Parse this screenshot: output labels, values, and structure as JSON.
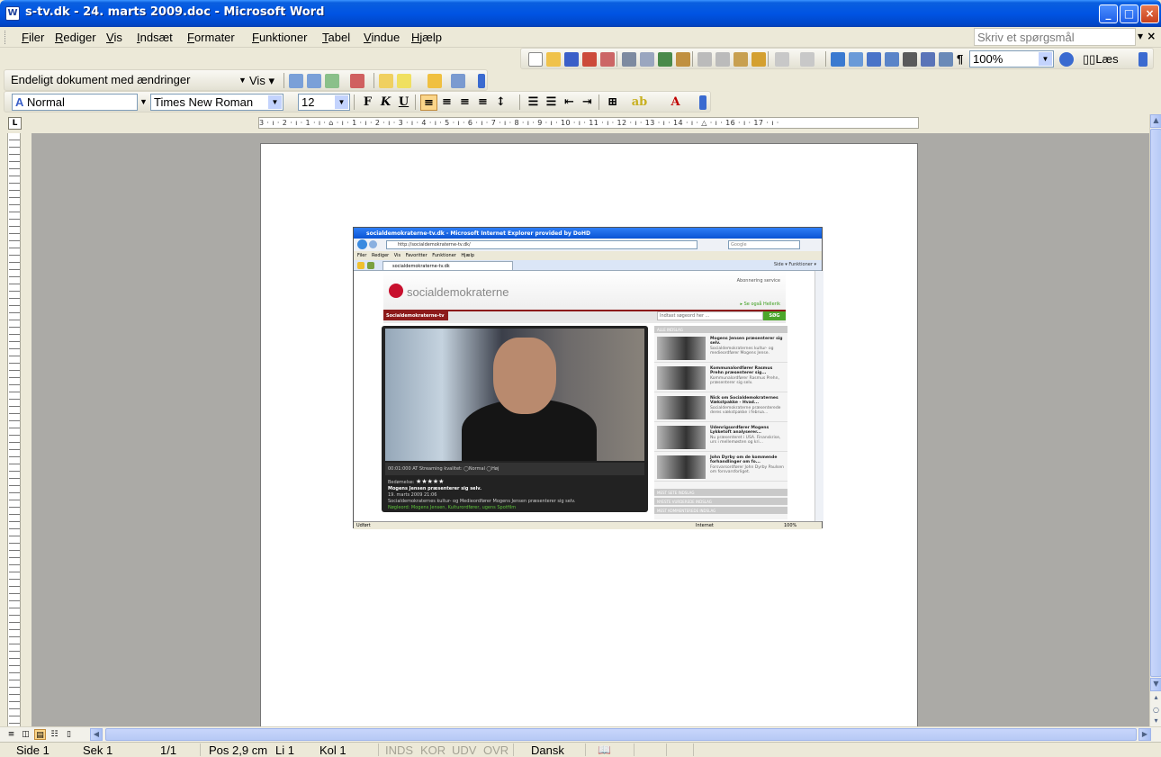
{
  "window": {
    "title": "s-tv.dk - 24. marts 2009.doc - Microsoft Word",
    "minimize": "_",
    "maximize": "□",
    "close": "×"
  },
  "menu": {
    "items": [
      "Filer",
      "Rediger",
      "Vis",
      "Indsæt",
      "Formater",
      "Funktioner",
      "Tabel",
      "Vindue",
      "Hjælp"
    ],
    "ask_placeholder": "Skriv et spørgsmål",
    "ask_close": "×"
  },
  "standard_toolbar": {
    "zoom": "100%",
    "read_label": "Læs"
  },
  "review_toolbar": {
    "display_for_review": "Endeligt dokument med ændringer",
    "show_label": "Vis"
  },
  "formatting_toolbar": {
    "style": "Normal",
    "font": "Times New Roman",
    "size": "12",
    "bold": "F",
    "italic": "K",
    "underline": "U"
  },
  "ruler": {
    "ticks": "3 · ı · 2 · ı · 1 · ı · ⌂ · ı · 1 · ı · 2 · ı · 3 · ı · 4 · ı · 5 · ı · 6 · ı · 7 · ı · 8 · ı · 9 · ı · 10 · ı · 11 · ı · 12 · ı · 13 · ı · 14 · ı · △ · ı · 16 · ı · 17 · ı ·",
    "tab_selector": "L"
  },
  "embedded_screenshot": {
    "ie_title": "socialdemokraterne-tv.dk - Microsoft Internet Explorer provided by DoHD",
    "address": "http://socialdemokraterne-tv.dk/",
    "search_placeholder": "Google",
    "ie_menu": "Filer  Rediger  Vis  Favoritter  Funktioner  Hjælp",
    "tab_label": "socialdemokraterne-tv.dk",
    "ie_right_tools": "Side ▾  Funktioner ▾",
    "site_logo": "socialdemokraterne",
    "abonner": "Abonnering service",
    "heller": "▸ Se også Hellerik",
    "section_tab": "Socialdemokraterne-tv",
    "search_input": "Indtast søgeord her ...",
    "search_button": "SØG",
    "controls": "00:01:000 AT     Streaming kvalitet: ◯Normal ◯Høj",
    "rating_label": "Bedømelse:",
    "video_title": "Mogens Jensen præsenterer sig selv.",
    "video_date": "19. marts 2009 21:06",
    "video_desc": "Socialdemokraternes kultur- og Medieordfører Mogens Jensen præsenterer sig selv.",
    "video_tags": "Nøgleord: Mogens Jensen, Kulturordfører, ugens Spotfilm",
    "stars": "★★★★★",
    "sidebar_header": "ALLE INDSLAG",
    "items": [
      {
        "title": "Mogens Jensen præsenterer sig selv.",
        "desc": "Socialdemokraternes kultur- og medieordfører Mogens Jense."
      },
      {
        "title": "Kommunalordfører Rasmus Prehn præsenterer sig...",
        "desc": "Kommunalordfører Rasmus Prehn, præsenterer sig selv."
      },
      {
        "title": "Nick om Socialdemokraternes Vækstpakke - Hvad...",
        "desc": "Socialdemokraterne præsenterede deres vækstpakke i februa..."
      },
      {
        "title": "Udenrigsordfører Mogens Lykketoft analyserer...",
        "desc": "Nu præsenteret i USA. Finanskrise, urs i mellemøsten og kri..."
      },
      {
        "title": "John Dyrby om de kommende forhandlinger om fo...",
        "desc": "Forsvarsordfører John Dyrby Paulsen om forsvarsforliget."
      }
    ],
    "sidebar_sections": [
      "MEST SETE INDSLAG",
      "NYESTE VURDEREDE INDSLAG",
      "MEST KOMMENTEREDE INDSLAG"
    ],
    "status_left": "Udført",
    "status_zone": "Internet",
    "status_zoom": "100%"
  },
  "statusbar": {
    "page": "Side 1",
    "section": "Sek 1",
    "pages": "1/1",
    "position": "Pos 2,9 cm",
    "line": "Li 1",
    "column": "Kol 1",
    "rec": "INDS",
    "trk": "KOR",
    "ext": "UDV",
    "ovr": "OVR",
    "language": "Dansk"
  }
}
